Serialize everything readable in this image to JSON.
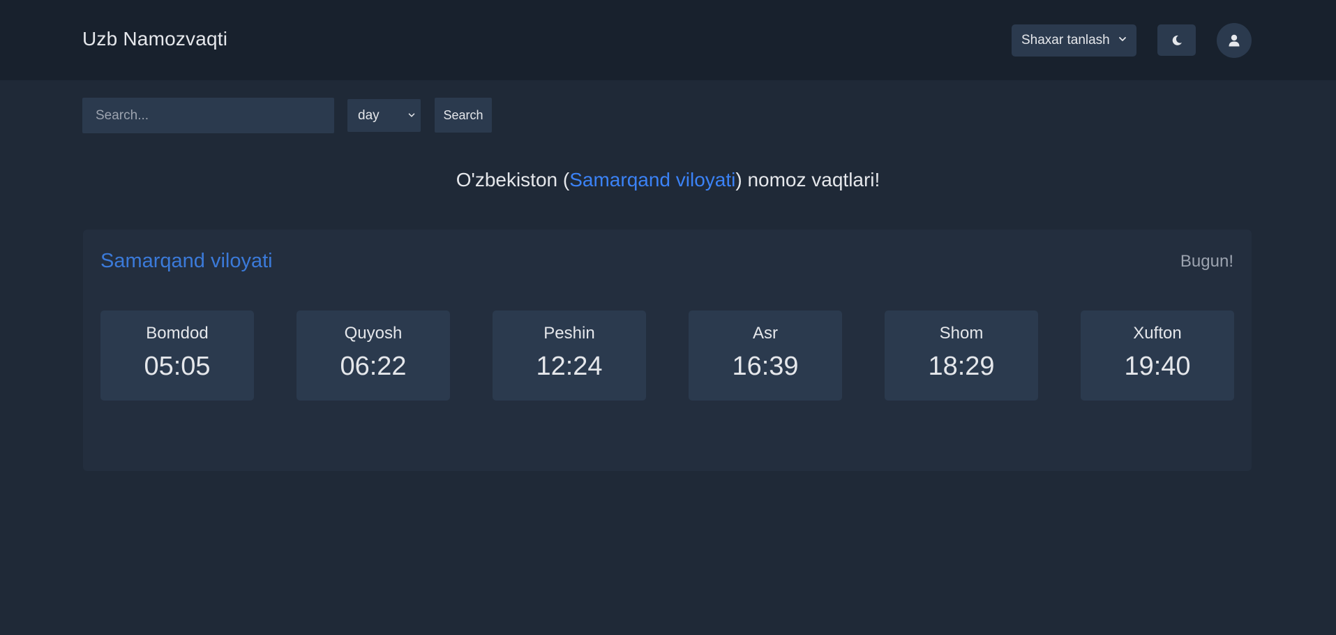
{
  "header": {
    "brand": "Uzb Namozvaqti",
    "city_select_label": "Shaxar tanlash",
    "theme_icon": "moon-icon",
    "user_icon": "user-icon"
  },
  "toolbar": {
    "search_placeholder": "Search...",
    "period_value": "day",
    "search_label": "Search"
  },
  "heading": {
    "prefix": "O'zbekiston (",
    "region": "Samarqand viloyati",
    "suffix": ") nomoz vaqtlari!"
  },
  "card": {
    "title": "Samarqand viloyati",
    "today_label": "Bugun!",
    "times": [
      {
        "name": "Bomdod",
        "time": "05:05"
      },
      {
        "name": "Quyosh",
        "time": "06:22"
      },
      {
        "name": "Peshin",
        "time": "12:24"
      },
      {
        "name": "Asr",
        "time": "16:39"
      },
      {
        "name": "Shom",
        "time": "18:29"
      },
      {
        "name": "Xufton",
        "time": "19:40"
      }
    ]
  },
  "colors": {
    "accent": "#3b82f6",
    "background": "#1f2937",
    "navbar": "#18212d",
    "tile": "#2b3a4e"
  }
}
